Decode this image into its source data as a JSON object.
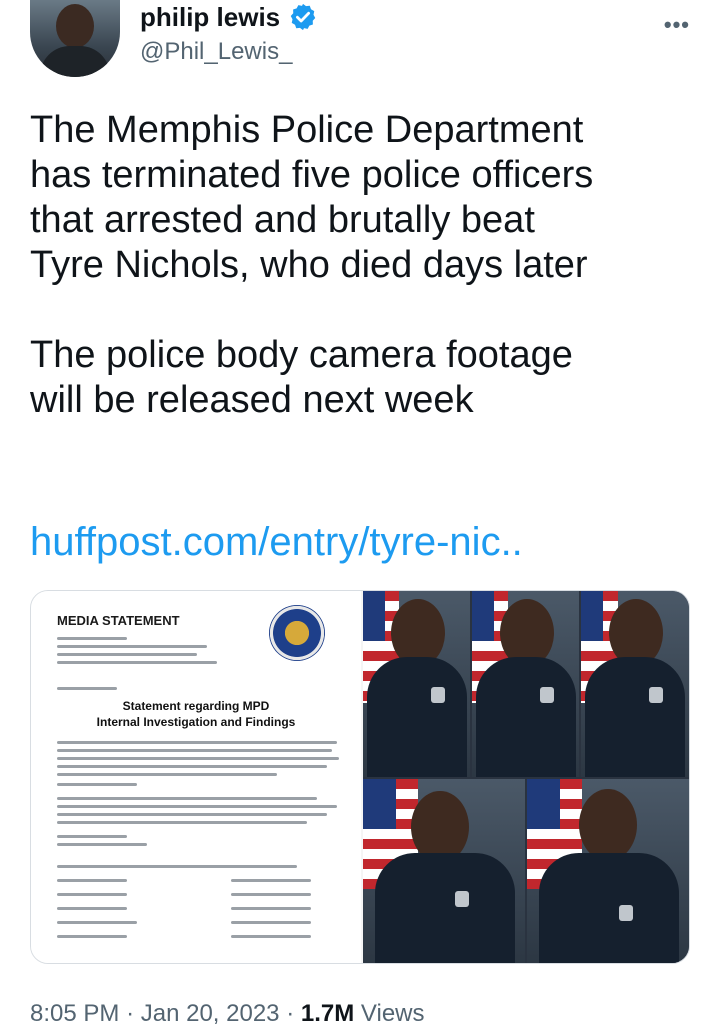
{
  "author": {
    "display_name": "philip lewis",
    "handle": "@Phil_Lewis_",
    "verified_color": "#1d9bf0"
  },
  "tweet": {
    "paragraph1": [
      "The Memphis Police Department",
      "has terminated five police officers",
      "that arrested and brutally beat",
      "Tyre Nichols,  who died days later"
    ],
    "paragraph2": [
      "The police body camera footage",
      "will be released next week"
    ],
    "link": "huffpost.com/entry/tyre-nic.."
  },
  "media": {
    "document": {
      "title": "MEDIA STATEMENT",
      "heading_line1": "Statement regarding MPD",
      "heading_line2": "Internal Investigation and Findings"
    }
  },
  "meta": {
    "time": "8:05 PM",
    "separator": "·",
    "date": "Jan 20, 2023",
    "views_count": "1.7M",
    "views_label": "Views"
  },
  "icons": {
    "verified": "verified-badge-icon",
    "more": "more-options-icon"
  }
}
